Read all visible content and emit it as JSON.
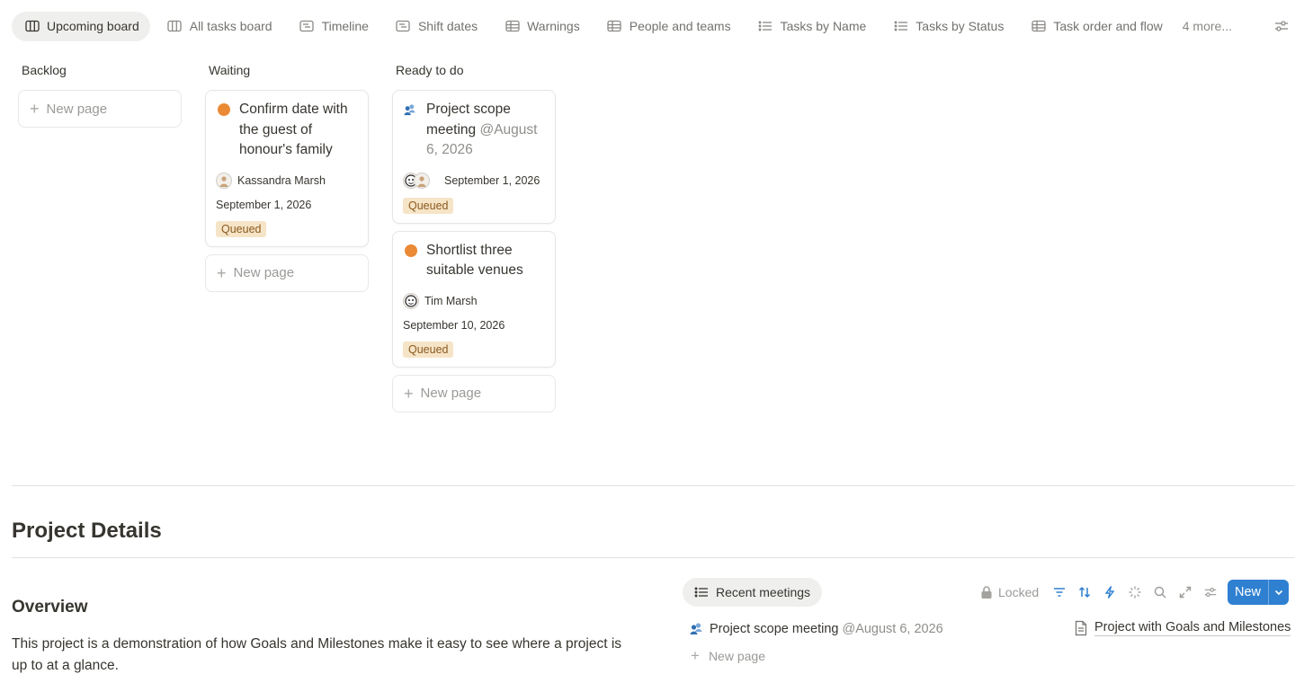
{
  "tabs": [
    {
      "label": "Upcoming board",
      "icon": "board-icon",
      "active": true
    },
    {
      "label": "All tasks board",
      "icon": "board-icon"
    },
    {
      "label": "Timeline",
      "icon": "timeline-icon"
    },
    {
      "label": "Shift dates",
      "icon": "timeline-icon"
    },
    {
      "label": "Warnings",
      "icon": "table-icon"
    },
    {
      "label": "People and teams",
      "icon": "table-icon"
    },
    {
      "label": "Tasks by Name",
      "icon": "list-icon"
    },
    {
      "label": "Tasks by Status",
      "icon": "list-icon"
    },
    {
      "label": "Task order and flow",
      "icon": "table-icon"
    }
  ],
  "tabs_more": "4 more...",
  "board": {
    "columns": [
      {
        "title": "Backlog",
        "cards": []
      },
      {
        "title": "Waiting",
        "cards": [
          {
            "title": "Confirm date with the guest of honour's family",
            "icon": "orange-dot-icon",
            "person": "Kassandra Marsh",
            "date": "September 1, 2026",
            "status": "Queued"
          }
        ]
      },
      {
        "title": "Ready to do",
        "cards": [
          {
            "title": "Project scope meeting",
            "mention": "@August 6, 2026",
            "icon": "meeting-icon",
            "date": "September 1, 2026",
            "status": "Queued"
          },
          {
            "title": "Shortlist three suitable venues",
            "icon": "orange-dot-icon",
            "person": "Tim Marsh",
            "date": "September 10, 2026",
            "status": "Queued"
          }
        ]
      }
    ],
    "new_page_label": "New page"
  },
  "details": {
    "heading": "Project Details",
    "overview_heading": "Overview",
    "overview_text": "This project is a demonstration of how Goals and Milestones make it easy to see where a project is up to at a glance."
  },
  "linked_db": {
    "view_label": "Recent meetings",
    "locked_label": "Locked",
    "new_label": "New",
    "row_title": "Project scope meeting",
    "row_mention": "@August 6, 2026",
    "new_page_label": "New page",
    "related_page": "Project with Goals and Milestones"
  },
  "colors": {
    "accent": "#2f80d1",
    "status_bg": "#f6e4c7",
    "status_fg": "#8b5a1f",
    "dot": "#ea8a35"
  }
}
